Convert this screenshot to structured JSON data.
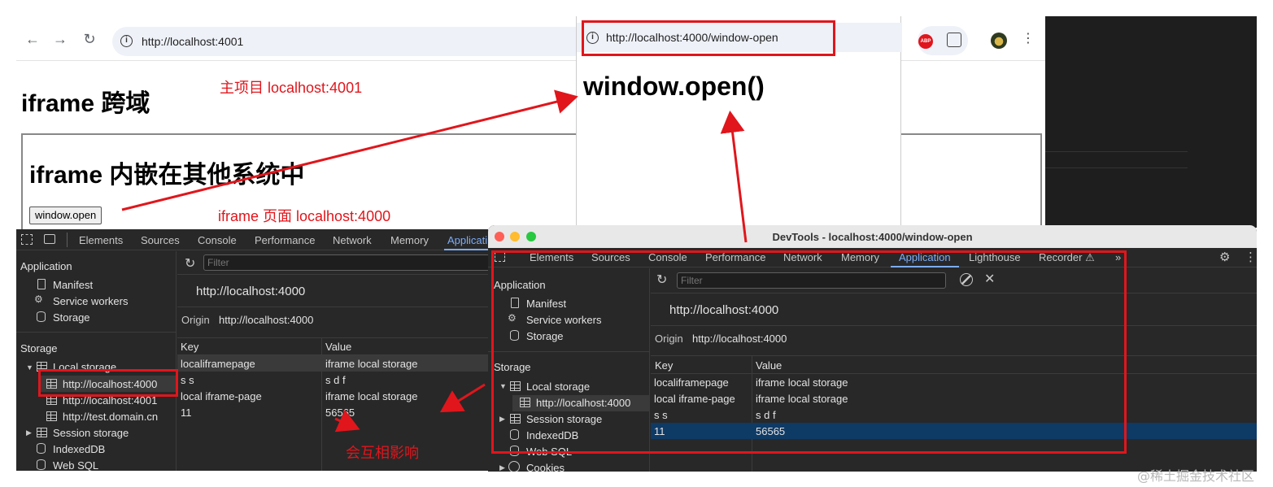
{
  "main_browser": {
    "url": "http://localhost:4001",
    "page_title": "iframe 跨域",
    "iframe_title": "iframe 内嵌在其他系统中",
    "button_label": "window.open",
    "extensions": {
      "abp_label": "ABP"
    }
  },
  "popup": {
    "url": "http://localhost:4000/window-open",
    "heading": "window.open()"
  },
  "annotations": {
    "main_project": "主项目 localhost:4001",
    "iframe_page": "iframe 页面 localhost:4000",
    "affect_each_other": "会互相影响"
  },
  "devtools_left": {
    "tabs": [
      "Elements",
      "Sources",
      "Console",
      "Performance",
      "Network",
      "Memory",
      "Applicati"
    ],
    "active_tab": "Applicati",
    "sidebar": {
      "application_header": "Application",
      "application_items": [
        "Manifest",
        "Service workers",
        "Storage"
      ],
      "storage_header": "Storage",
      "local_storage": "Local storage",
      "local_storage_origins": [
        "http://localhost:4000",
        "http://localhost:4001",
        "http://test.domain.cn"
      ],
      "session_storage": "Session storage",
      "indexeddb": "IndexedDB",
      "websql": "Web SQL"
    },
    "filter_placeholder": "Filter",
    "origin_heading": "http://localhost:4000",
    "origin_label": "Origin",
    "origin_value": "http://localhost:4000",
    "columns": [
      "Key",
      "Value"
    ],
    "rows": [
      {
        "key": "localiframepage",
        "value": "iframe local storage"
      },
      {
        "key": "s s",
        "value": "s d f"
      },
      {
        "key": "local iframe-page",
        "value": "iframe local storage"
      },
      {
        "key": "11",
        "value": "56565"
      }
    ]
  },
  "devtools_right": {
    "window_title": "DevTools - localhost:4000/window-open",
    "tabs": [
      "Elements",
      "Sources",
      "Console",
      "Performance",
      "Network",
      "Memory",
      "Application",
      "Lighthouse",
      "Recorder ⚠",
      "»"
    ],
    "active_tab": "Application",
    "sidebar": {
      "application_header": "Application",
      "application_items": [
        "Manifest",
        "Service workers",
        "Storage"
      ],
      "storage_header": "Storage",
      "local_storage": "Local storage",
      "local_storage_origins": [
        "http://localhost:4000"
      ],
      "session_storage": "Session storage",
      "indexeddb": "IndexedDB",
      "websql": "Web SQL",
      "cookies": "Cookies"
    },
    "filter_placeholder": "Filter",
    "origin_heading": "http://localhost:4000",
    "origin_label": "Origin",
    "origin_value": "http://localhost:4000",
    "columns": [
      "Key",
      "Value"
    ],
    "rows": [
      {
        "key": "localiframepage",
        "value": "iframe local storage"
      },
      {
        "key": "local iframe-page",
        "value": "iframe local storage"
      },
      {
        "key": "s s",
        "value": "s d f"
      },
      {
        "key": "11",
        "value": "56565"
      }
    ]
  },
  "watermark": "@稀土掘金技术社区",
  "colors": {
    "annotation_red": "#e0161c",
    "devtools_bg": "#282828",
    "active_tab": "#7cacf8",
    "selected_row": "#0e3a66"
  }
}
